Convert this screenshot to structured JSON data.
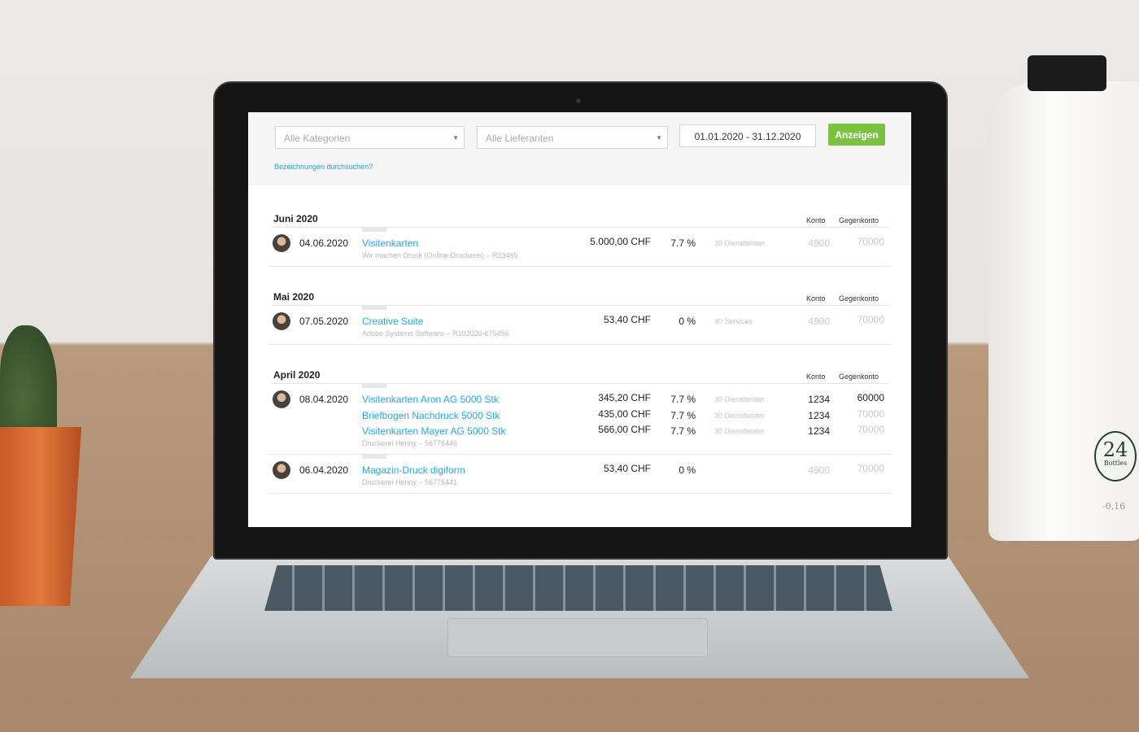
{
  "filters": {
    "category_placeholder": "Alle Kategorien",
    "supplier_placeholder": "Alle Lieferanten",
    "date_range": "01.01.2020 - 31.12.2020",
    "submit_label": "Anzeigen",
    "search_link": "Bezeichnungen durchsuchen?"
  },
  "columns": {
    "konto": "Konto",
    "gegenkonto": "Gegenkonto"
  },
  "sections": [
    {
      "title": "Juni 2020",
      "entries": [
        {
          "date": "04.06.2020",
          "supplier": "Wir machen Druck (Online-Druckerei) – R23465",
          "lines": [
            {
              "desc": "Visitenkarten",
              "amount": "5.000,00 CHF",
              "vat": "7.7 %",
              "category": "30 Dienstleister",
              "konto": "4900",
              "gegenkonto": "70000",
              "konto_set": false,
              "gegenkonto_set": false
            }
          ]
        }
      ]
    },
    {
      "title": "Mai 2020",
      "entries": [
        {
          "date": "07.05.2020",
          "supplier": "Adobe Systems Software – R102020-675456",
          "lines": [
            {
              "desc": "Creative Suite",
              "amount": "53,40 CHF",
              "vat": "0 %",
              "category": "40 Services",
              "konto": "4900",
              "gegenkonto": "70000",
              "konto_set": false,
              "gegenkonto_set": false
            }
          ]
        }
      ]
    },
    {
      "title": "April 2020",
      "entries": [
        {
          "date": "08.04.2020",
          "supplier": "Druckerei Henny  – 56776446",
          "lines": [
            {
              "desc": "Visitenkarten Aron AG 5000 Stk",
              "amount": "345,20 CHF",
              "vat": "7.7 %",
              "category": "30 Dienstleister",
              "konto": "1234",
              "gegenkonto": "60000",
              "konto_set": true,
              "gegenkonto_set": true
            },
            {
              "desc": "Briefbogen Nachdruck 5000 Stk",
              "amount": "435,00 CHF",
              "vat": "7.7 %",
              "category": "30 Dienstleister",
              "konto": "1234",
              "gegenkonto": "70000",
              "konto_set": true,
              "gegenkonto_set": false
            },
            {
              "desc": "Visitenkarten Mayer AG 5000 Stk",
              "amount": "566,00 CHF",
              "vat": "7.7 %",
              "category": "30 Dienstleister",
              "konto": "1234",
              "gegenkonto": "70000",
              "konto_set": true,
              "gegenkonto_set": false
            }
          ]
        },
        {
          "date": "06.04.2020",
          "supplier": "Druckerei Henny – 56776441",
          "lines": [
            {
              "desc": "Magazin-Druck digiform",
              "amount": "53,40 CHF",
              "vat": "0 %",
              "category": "",
              "konto": "4900",
              "gegenkonto": "70000",
              "konto_set": false,
              "gegenkonto_set": false
            }
          ]
        }
      ]
    }
  ],
  "scene": {
    "bottle_brand": "24 Bottles",
    "bottle_text": "-0,16"
  },
  "colors": {
    "accent": "#2aa5e0",
    "button": "#7cc142"
  }
}
